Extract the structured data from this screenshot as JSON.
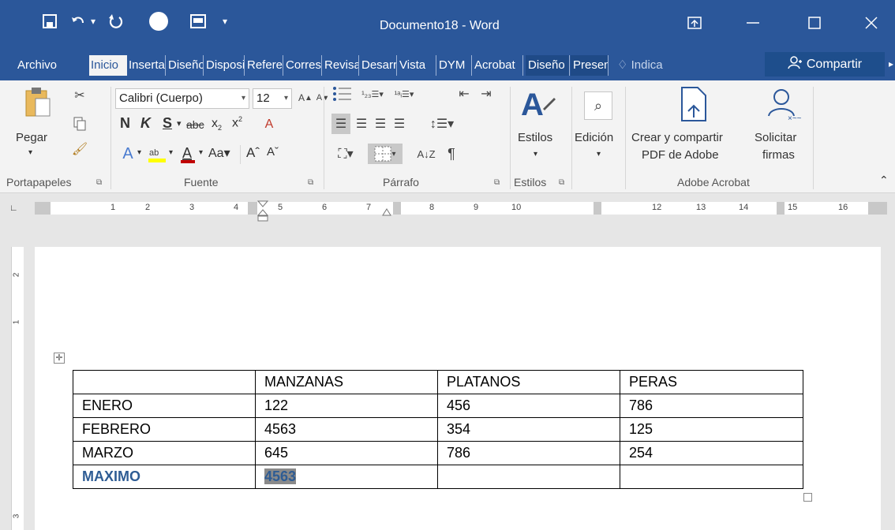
{
  "window": {
    "title": "Documento18 - Word"
  },
  "tabs": [
    {
      "label": "Archivo"
    },
    {
      "label": "Inicio"
    },
    {
      "label": "Insertar"
    },
    {
      "label": "Diseño"
    },
    {
      "label": "Disposición"
    },
    {
      "label": "Referencias"
    },
    {
      "label": "Correspondencia"
    },
    {
      "label": "Revisar"
    },
    {
      "label": "Desarrollador"
    },
    {
      "label": "Vista"
    },
    {
      "label": "DYM"
    },
    {
      "label": "Acrobat"
    },
    {
      "label": "Diseño"
    },
    {
      "label": "Presentación"
    }
  ],
  "tell_me": "Indica",
  "share_label": "Compartir",
  "ribbon": {
    "paste_label": "Pegar",
    "font_name": "Calibri (Cuerpo)",
    "font_size": "12",
    "bold": "N",
    "italic": "K",
    "underline": "S",
    "strike": "abc",
    "styles_label": "Estilos",
    "edit_label": "Edición",
    "create_pdf_line1": "Crear y compartir",
    "create_pdf_line2": "PDF de Adobe",
    "sign_line1": "Solicitar",
    "sign_line2": "firmas",
    "groups": {
      "clipboard": "Portapapeles",
      "font": "Fuente",
      "paragraph": "Párrafo",
      "styles": "Estilos",
      "acrobat": "Adobe Acrobat"
    }
  },
  "ruler": {
    "marks": [
      "1",
      "2",
      "3",
      "4",
      "5",
      "6",
      "7",
      "8",
      "9",
      "10",
      "12",
      "13",
      "14",
      "15",
      "16"
    ]
  },
  "vruler": {
    "marks": [
      "2",
      "1",
      "3"
    ]
  },
  "table": {
    "header": [
      "",
      "MANZANAS",
      "PLATANOS",
      "PERAS"
    ],
    "rows": [
      [
        "ENERO",
        "122",
        "456",
        "786"
      ],
      [
        "FEBRERO",
        "4563",
        "354",
        "125"
      ],
      [
        "MARZO",
        "645",
        "786",
        "254"
      ]
    ],
    "max_row": [
      "MAXIMO",
      "4563",
      "",
      ""
    ]
  },
  "colors": {
    "accent": "#2b579a",
    "max_text": "#2e5c94",
    "selection": "#8a8a8a"
  }
}
